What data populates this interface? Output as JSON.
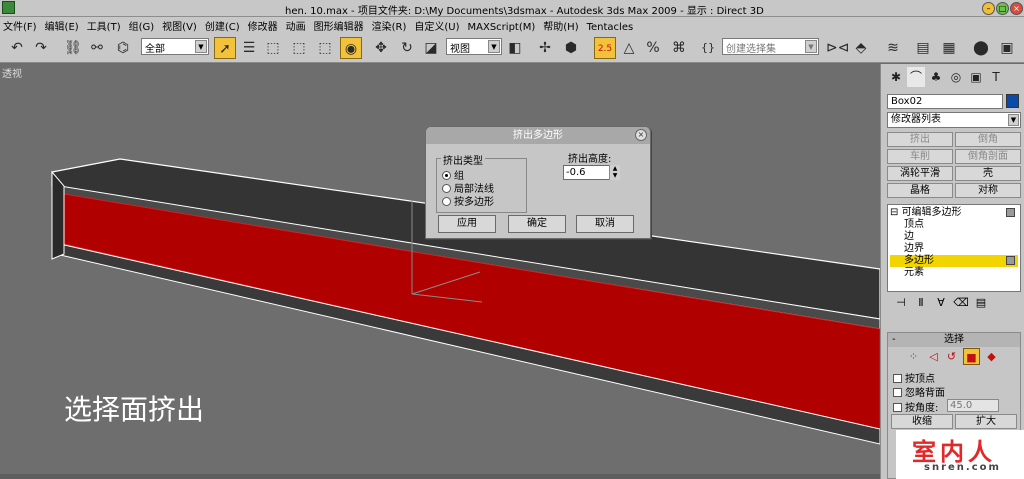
{
  "titlebar": {
    "title": "hen. 10.max    - 项目文件夹: D:\\My Documents\\3dsmax    - Autodesk 3ds Max  2009    - 显示 : Direct 3D"
  },
  "menu": {
    "items": [
      "文件(F)",
      "编辑(E)",
      "工具(T)",
      "组(G)",
      "视图(V)",
      "创建(C)",
      "修改器",
      "动画",
      "图形编辑器",
      "渲染(R)",
      "自定义(U)",
      "MAXScript(M)",
      "帮助(H)",
      "Tentacles"
    ]
  },
  "toolbar": {
    "filter_value": "全部",
    "coord_value": "视图",
    "selection_set_placeholder": "创建选择集",
    "snap_value": "2.5"
  },
  "viewport": {
    "label": "透视",
    "overlay_text": "选择面挤出",
    "colors": {
      "extrusion_face": "#b00000",
      "beam_top": "#3a3a3a"
    }
  },
  "dialog": {
    "title": "挤出多边形",
    "group_label": "挤出类型",
    "options": [
      "组",
      "局部法线",
      "按多边形"
    ],
    "selected_option": "组",
    "height_label": "挤出高度:",
    "height_value": "-0.6",
    "buttons": {
      "apply": "应用",
      "ok": "确定",
      "cancel": "取消"
    }
  },
  "command_panel": {
    "object_name": "Box02",
    "object_color": "#0a4aa8",
    "modifier_list": "修改器列表",
    "buttons": [
      {
        "label": "挤出",
        "enabled": false
      },
      {
        "label": "倒角",
        "enabled": false
      },
      {
        "label": "车削",
        "enabled": false
      },
      {
        "label": "倒角剖面",
        "enabled": false
      },
      {
        "label": "涡轮平滑",
        "enabled": true
      },
      {
        "label": "壳",
        "enabled": true
      },
      {
        "label": "晶格",
        "enabled": true
      },
      {
        "label": "对称",
        "enabled": true
      }
    ],
    "stack": {
      "root": "可编辑多边形",
      "sub": [
        "顶点",
        "边",
        "边界",
        "多边形",
        "元素"
      ],
      "selected": "多边形"
    },
    "selection_rollout": {
      "title": "选择",
      "checks": [
        "按顶点",
        "忽略背面",
        "按角度:"
      ],
      "angle_value": "45.0",
      "shrink": "收缩",
      "grow": "扩大"
    }
  },
  "watermark": {
    "text": "室内人",
    "sub": "snren.com"
  }
}
